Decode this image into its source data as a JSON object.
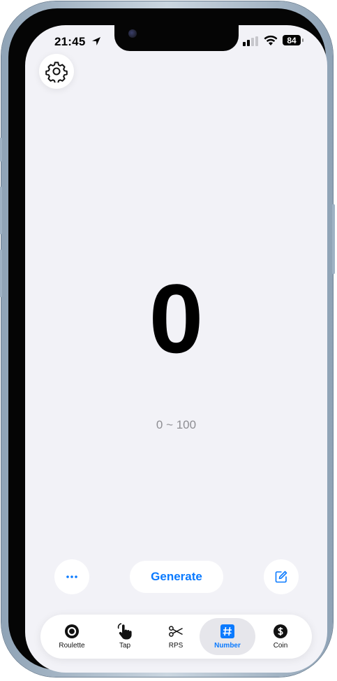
{
  "status_bar": {
    "time": "21:45",
    "battery": "84"
  },
  "main": {
    "number": "0",
    "range": "0 ~ 100"
  },
  "actions": {
    "generate_label": "Generate"
  },
  "tabs": [
    {
      "label": "Roulette",
      "icon": "roulette-icon",
      "active": false
    },
    {
      "label": "Tap",
      "icon": "hand-tap-icon",
      "active": false
    },
    {
      "label": "RPS",
      "icon": "scissors-icon",
      "active": false
    },
    {
      "label": "Number",
      "icon": "hash-icon",
      "active": true
    },
    {
      "label": "Coin",
      "icon": "dollar-coin-icon",
      "active": false
    }
  ],
  "colors": {
    "accent": "#0a7aff",
    "background": "#f2f2f7",
    "secondary_text": "#8e8e93"
  }
}
